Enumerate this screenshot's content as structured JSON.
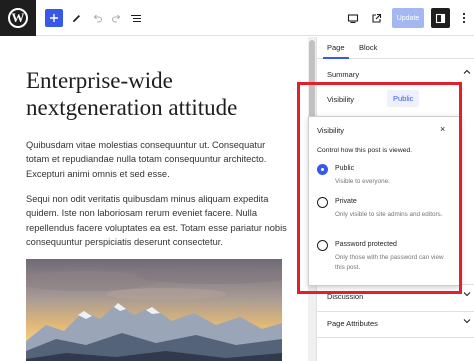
{
  "toolbar": {
    "logo": "W",
    "update_label": "Update",
    "icons": [
      "wordpress-logo",
      "plus-icon",
      "pencil-icon",
      "undo-icon",
      "redo-icon",
      "list-view-icon",
      "desktop-preview-icon",
      "external-link-icon",
      "sidebar-icon",
      "more-vertical-icon"
    ]
  },
  "editor": {
    "title": "Enterprise-wide nextgeneration attitude",
    "paragraph_1": "Quibusdam vitae molestias consequuntur ut. Consequatur totam et repudiandae nulla totam consequuntur architecto. Excepturi animi omnis et sed esse.",
    "paragraph_2": "Sequi non odit veritatis quibusdam minus aliquam expedita quidem. Iste non laboriosam rerum eveniet facere. Nulla repellendus facere voluptates ea est. Totam esse pariatur nobis consequuntur perspiciatis deserunt consectetur."
  },
  "sidebar": {
    "tabs": [
      {
        "label": "Page",
        "active": true
      },
      {
        "label": "Block",
        "active": false
      }
    ],
    "summary_label": "Summary",
    "visibility_label": "Visibility",
    "visibility_value": "Public",
    "discussion_label": "Discussion",
    "page_attributes_label": "Page Attributes"
  },
  "popover": {
    "title": "Visibility",
    "close": "×",
    "description": "Control how this post is viewed.",
    "options": [
      {
        "label": "Public",
        "help": "Visible to everyone.",
        "checked": true
      },
      {
        "label": "Private",
        "help": "Only visible to site admins and editors.",
        "checked": false
      },
      {
        "label": "Password protected",
        "help": "Only those with the password can view this post.",
        "checked": false
      }
    ]
  },
  "colors": {
    "accent": "#3858e9",
    "highlight": "#e0202a",
    "dark": "#1e1e1e"
  }
}
